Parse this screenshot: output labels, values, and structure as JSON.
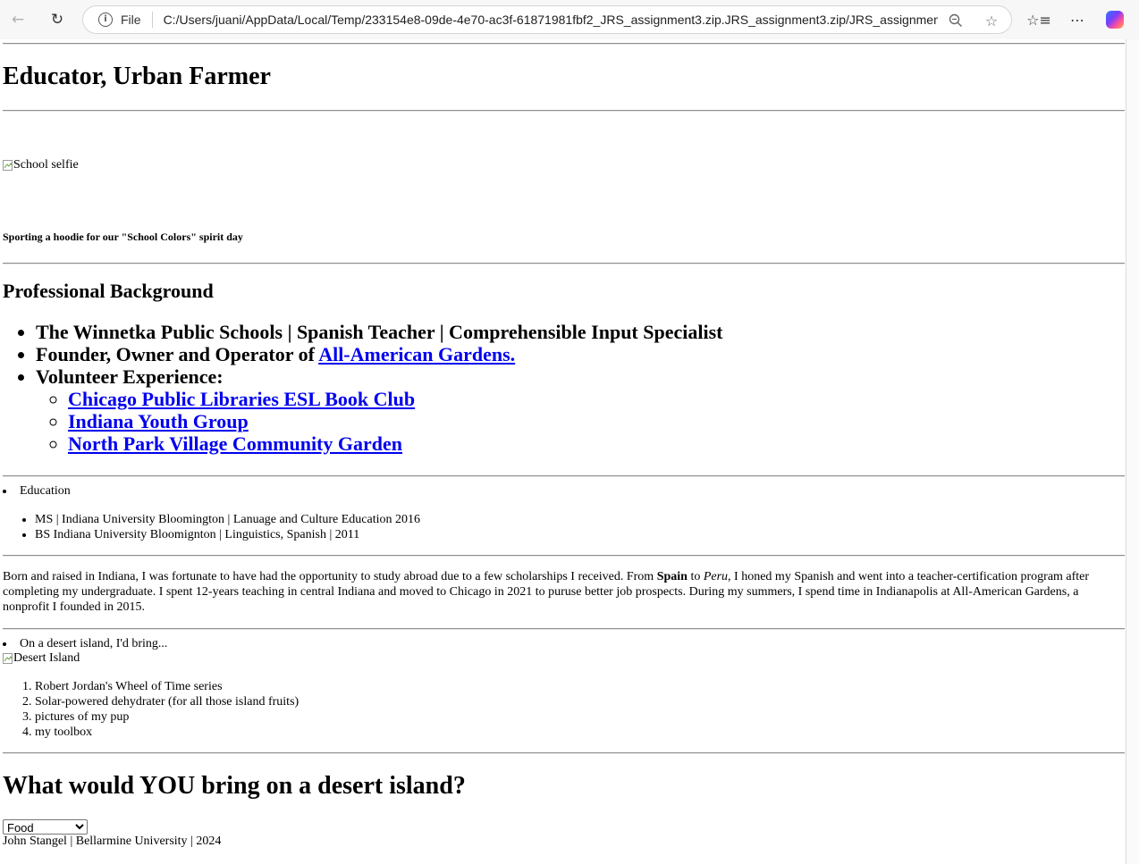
{
  "browser": {
    "file_label": "File",
    "url": "C:/Users/juani/AppData/Local/Temp/233154e8-09de-4e70-ac3f-61871981fbf2_JRS_assignment3.zip.JRS_assignment3.zip/JRS_assignment3..."
  },
  "page": {
    "title": "Educator, Urban Farmer",
    "school_image_alt": "School selfie",
    "school_caption": "Sporting a hoodie for our \"School Colors\" spirit day",
    "professional": {
      "heading": "Professional Background",
      "item1": "The Winnetka Public Schools | Spanish Teacher | Comprehensible Input Specialist",
      "item2_prefix": "Founder, Owner and Operator of ",
      "item2_link": "All-American Gardens.",
      "item3": "Volunteer Experience:",
      "volunteer": [
        "Chicago Public Libraries ESL Book Club",
        "Indiana Youth Group",
        "North Park Village Community Garden"
      ]
    },
    "education": {
      "heading": "Education",
      "items": [
        "MS | Indiana University Bloomington | Lanuage and Culture Education 2016",
        "BS Indiana University Bloomignton | Linguistics, Spanish | 2011"
      ]
    },
    "bio": {
      "part1": "Born and raised in Indiana, I was fortunate to have had the opportunity to study abroad due to a few scholarships I received. From ",
      "spain": "Spain",
      "to": " to ",
      "peru": "Peru",
      "part2": ", I honed my Spanish and went into a teacher-certification program after completing my undergraduate. I spent 12-years teaching in central Indiana and moved to Chicago in 2021 to puruse better job prospects. During my summers, I spend time in Indianapolis at All-American Gardens, a nonprofit I founded in 2015."
    },
    "island": {
      "heading": "On a desert island, I'd bring...",
      "image_alt": "Desert Island",
      "items": [
        "Robert Jordan's Wheel of Time series",
        "Solar-powered dehydrater (for all those island fruits)",
        "pictures of my pup",
        "my toolbox"
      ]
    },
    "question": "What would YOU bring on a desert island?",
    "dropdown_selected": "Food",
    "footer": "John Stangel | Bellarmine University | 2024"
  }
}
